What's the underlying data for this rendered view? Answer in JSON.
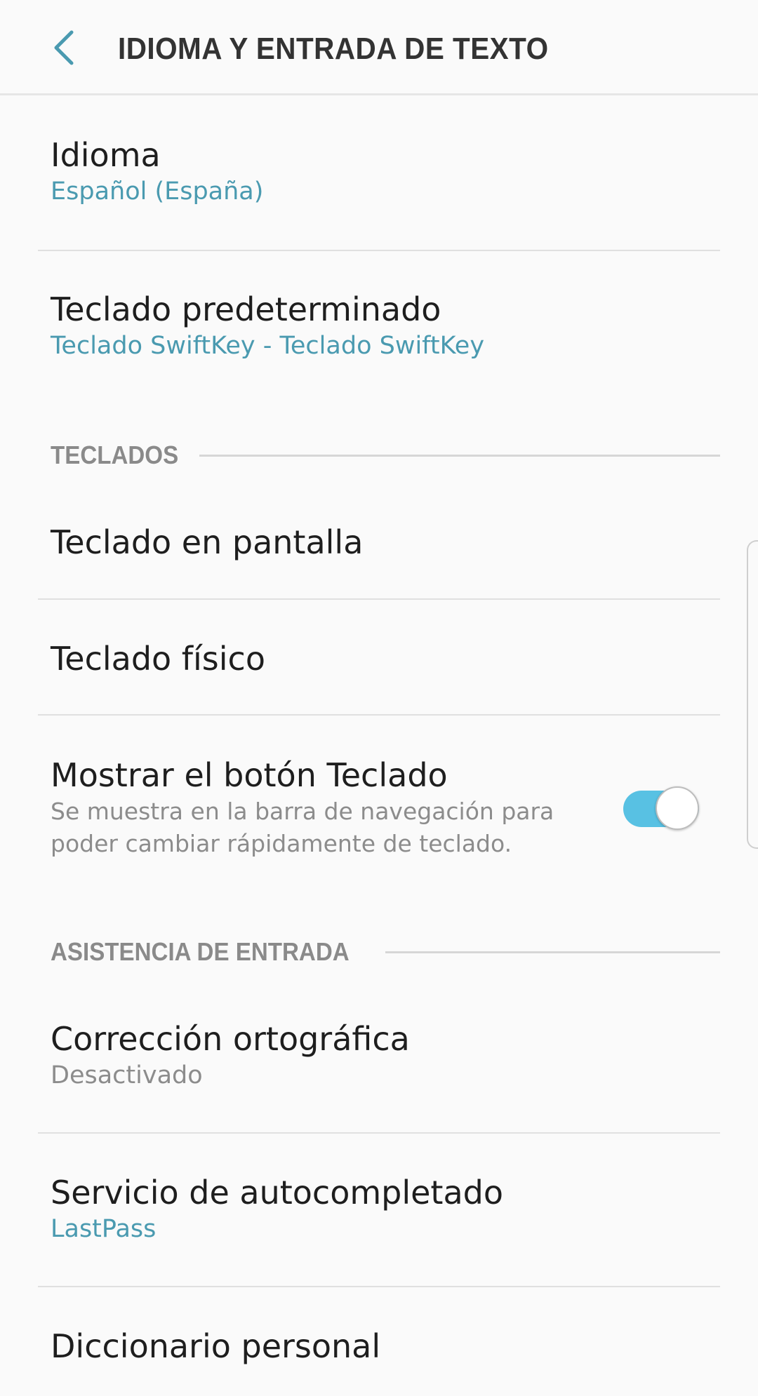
{
  "header": {
    "title": "IDIOMA Y ENTRADA DE TEXTO",
    "back_icon": "chevron-left-icon"
  },
  "colors": {
    "accent": "#4a9ab0",
    "toggle_on": "#58c1e3",
    "background": "#fafafa",
    "section_text": "#8a8a8a"
  },
  "items": {
    "language": {
      "title": "Idioma",
      "value": "Español (España)"
    },
    "default_keyboard": {
      "title": "Teclado predeterminado",
      "value": "Teclado SwiftKey - Teclado SwiftKey"
    }
  },
  "sections": {
    "keyboards": {
      "label": "TECLADOS",
      "items": {
        "on_screen": {
          "title": "Teclado en pantalla"
        },
        "physical": {
          "title": "Teclado físico"
        },
        "show_keyboard_button": {
          "title": "Mostrar el botón Teclado",
          "description": "Se muestra en la barra de navegación para poder cambiar rápidamente de teclado.",
          "enabled": true
        }
      }
    },
    "input_assistance": {
      "label": "ASISTENCIA DE ENTRADA",
      "items": {
        "spell_check": {
          "title": "Corrección ortográfica",
          "value": "Desactivado"
        },
        "autofill": {
          "title": "Servicio de autocompletado",
          "value": "LastPass"
        },
        "personal_dictionary": {
          "title": "Diccionario personal"
        }
      }
    }
  }
}
